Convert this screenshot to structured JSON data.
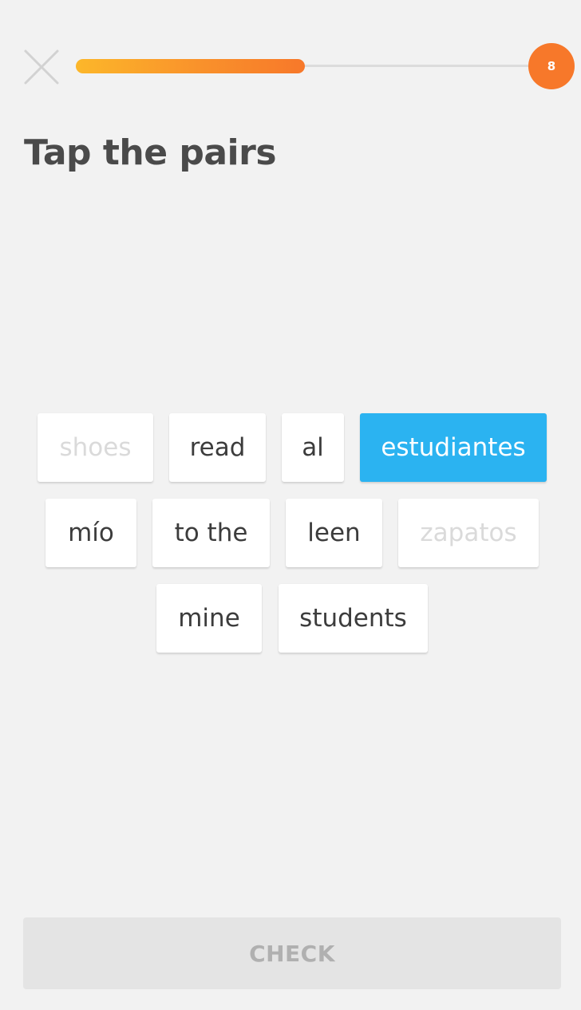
{
  "header": {
    "progress": 0.49,
    "streak_count": "8",
    "colors": {
      "progress_start": "#fcb72a",
      "progress_end": "#f7782a",
      "badge": "#f7782a"
    }
  },
  "lesson": {
    "prompt": "Tap the pairs"
  },
  "tiles": {
    "shoes": "shoes",
    "read": "read",
    "al": "al",
    "estudiantes": "estudiantes",
    "mio": "mío",
    "to_the": "to the",
    "leen": "leen",
    "zapatos": "zapatos",
    "mine": "mine",
    "students": "students"
  },
  "tile_states": {
    "matched": [
      "shoes",
      "zapatos"
    ],
    "selected": "estudiantes",
    "selected_color": "#2bb3f1"
  },
  "footer": {
    "check_label": "CHECK"
  }
}
